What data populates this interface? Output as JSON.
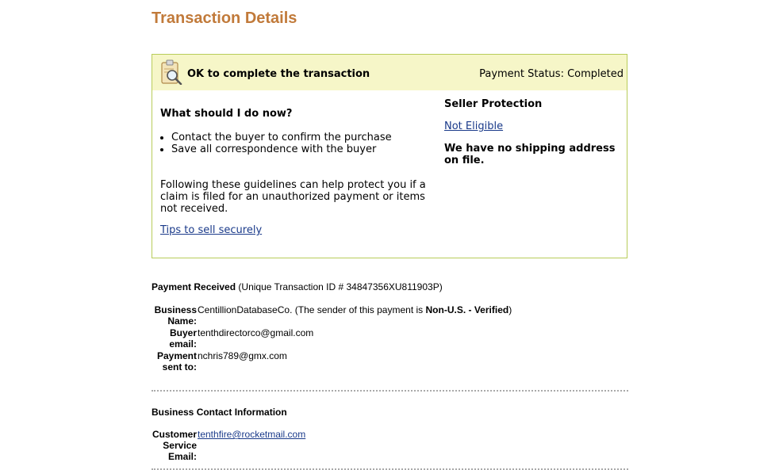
{
  "page_title": "Transaction Details",
  "notice": {
    "headline": "OK to complete the transaction",
    "status_label": "Payment Status:",
    "status_value": "Completed",
    "what_heading": "What should I do now?",
    "steps": [
      "Contact the buyer to confirm the purchase",
      "Save all correspondence with the buyer"
    ],
    "guideline_text": "Following these guidelines can help protect you if a claim is filed for an unauthorized payment or items not received.",
    "tips_link": "Tips to sell securely",
    "seller_protection_heading": "Seller Protection",
    "seller_protection_value": "Not Eligible",
    "shipping_note": "We have no shipping address on file."
  },
  "payment": {
    "title": "Payment Received",
    "txn_prefix": "(Unique Transaction ID #",
    "txn_id": "34847356XU811903P",
    "txn_suffix": ")",
    "business_label": "Business Name:",
    "business_value": "CentillionDatabaseCo.",
    "sender_prefix": "(The sender of this payment is",
    "sender_status": "Non-U.S. - Verified",
    "sender_suffix": ")",
    "buyer_label": "Buyer email:",
    "buyer_value": "tenthdirectorco@gmail.com",
    "sent_to_label": "Payment sent to:",
    "sent_to_value": "nchris789@gmx.com"
  },
  "contact": {
    "title": "Business Contact Information",
    "cs_label": "Customer Service Email:",
    "cs_value": "tenthfire@rocketmail.com"
  },
  "colors": {
    "title": "#c17a3a",
    "box_border": "#b8cc5a",
    "box_header": "#f6f6c8",
    "link": "#1a3a8a"
  }
}
